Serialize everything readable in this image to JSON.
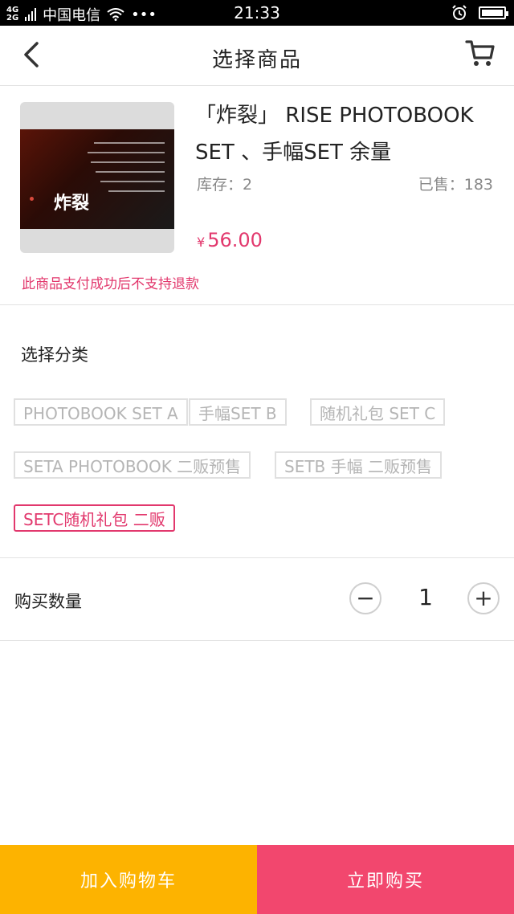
{
  "status_bar": {
    "network_top": "4G",
    "network_bottom": "2G",
    "carrier": "中国电信",
    "extra": "•••",
    "time": "21:33",
    "icons": [
      "signal-icon",
      "wifi-icon",
      "alarm-icon",
      "battery-icon"
    ]
  },
  "nav": {
    "title": "选择商品",
    "back_icon": "chevron-left-icon",
    "cart_icon": "cart-icon"
  },
  "product": {
    "title": "「炸裂」 RISE PHOTOBOOK SET 、手幅SET 余量",
    "stock": "库存：2",
    "sold": "已售：183",
    "price_symbol": "¥",
    "price": "56.00",
    "refund_note": "此商品支付成功后不支持退款",
    "thumb_brand": "炸裂"
  },
  "category": {
    "label": "选择分类",
    "options": [
      {
        "label": "PHOTOBOOK SET A",
        "selected": false
      },
      {
        "label": "手幅SET B",
        "selected": false
      },
      {
        "label": "随机礼包 SET C",
        "selected": false
      },
      {
        "label": "SETA PHOTOBOOK 二贩预售",
        "selected": false
      },
      {
        "label": "SETB 手幅 二贩预售",
        "selected": false
      },
      {
        "label": "SETC随机礼包 二贩",
        "selected": true
      }
    ]
  },
  "quantity": {
    "label": "购买数量",
    "value": "1",
    "minus": "−",
    "plus": "+"
  },
  "actions": {
    "add_to_cart": "加入购物车",
    "buy_now": "立即购买"
  },
  "colors": {
    "accent": "#e2386d",
    "add_to_cart_bg": "#fdb300",
    "buy_now_bg": "#f2476e"
  }
}
